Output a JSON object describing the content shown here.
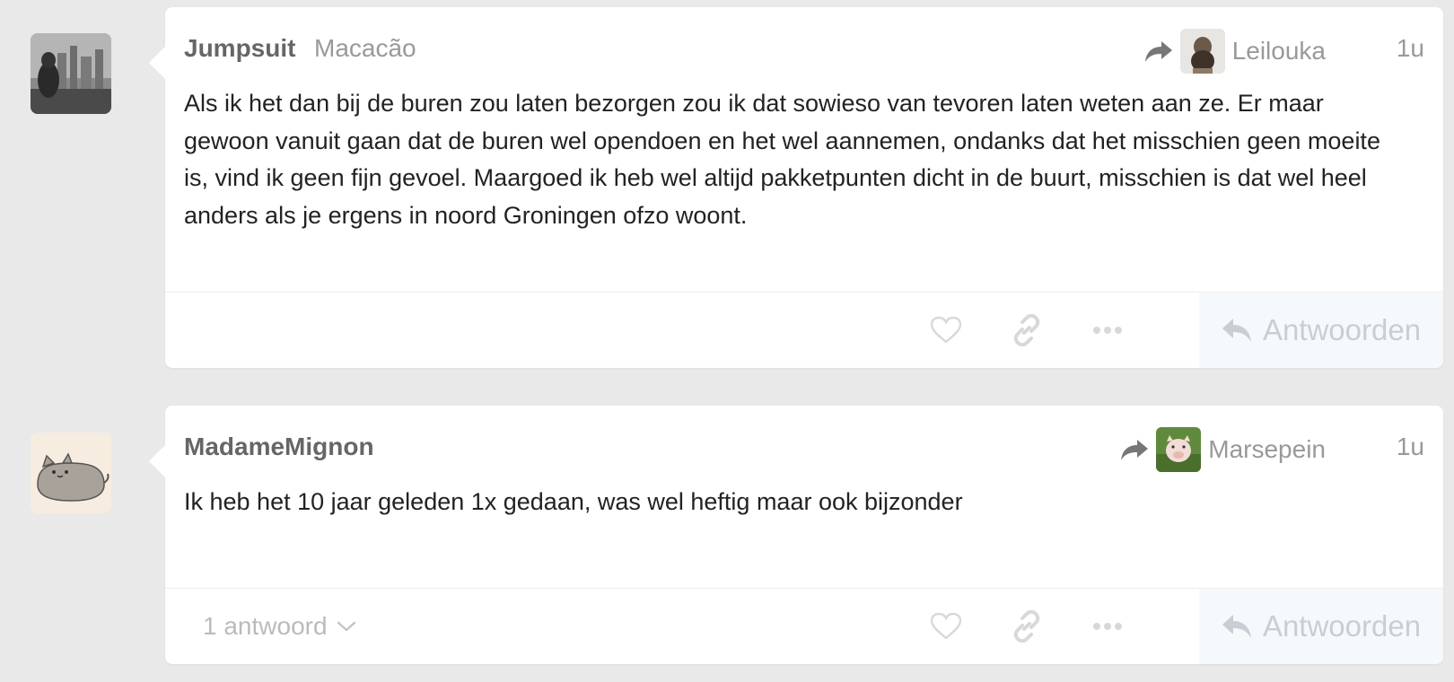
{
  "comments": [
    {
      "author": "Jumpsuit",
      "subtitle": "Macacão",
      "reply_to_user": "Leilouka",
      "time": "1u",
      "text": "Als ik het dan bij de buren zou laten bezorgen zou ik dat sowieso van tevoren laten weten aan ze. Er maar gewoon vanuit gaan dat de buren wel opendoen en het wel aannemen, ondanks dat het misschien geen moeite is, vind ik geen fijn gevoel. Maargoed ik heb wel altijd pakketpunten dicht in de buurt, misschien is dat wel heel anders als je ergens in noord Groningen ofzo woont.",
      "reply_label": "Antwoorden"
    },
    {
      "author": "MadameMignon",
      "reply_to_user": "Marsepein",
      "time": "1u",
      "text": "Ik heb het 10 jaar geleden 1x gedaan, was wel heftig maar ook bijzonder",
      "replies_toggle": "1 antwoord",
      "reply_label": "Antwoorden"
    }
  ],
  "icons": {
    "share": "share-arrow-icon",
    "like": "heart-icon",
    "link": "link-icon",
    "more": "more-dots-icon",
    "reply": "reply-arrow-icon",
    "chevron": "chevron-down-icon"
  },
  "colors": {
    "background": "#e9e9e9",
    "card": "#ffffff",
    "author": "#666666",
    "muted": "#999999",
    "reply_button_bg": "#f6f9fc"
  }
}
